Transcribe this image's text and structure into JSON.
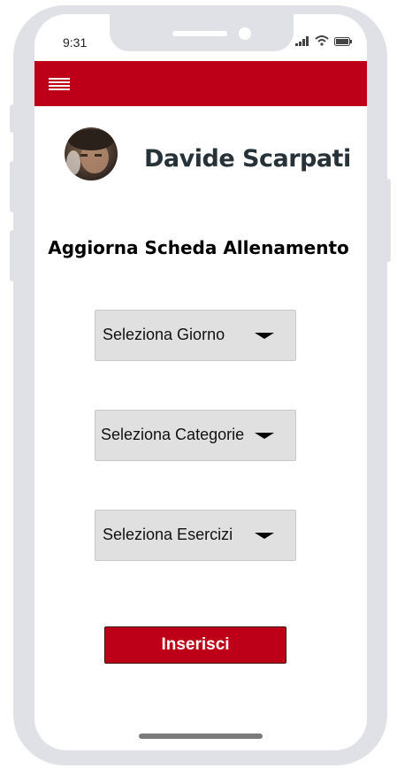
{
  "status_bar": {
    "time": "9:31",
    "icons": [
      "signal-icon",
      "wifi-icon",
      "battery-icon"
    ]
  },
  "header": {
    "menu_icon": "hamburger-menu-icon",
    "background_color": "#bd0017"
  },
  "profile": {
    "name": "Davide Scarpati"
  },
  "page": {
    "title": "Aggiorna Scheda Allenamento"
  },
  "form": {
    "day_select": {
      "value": "Seleziona Giorno"
    },
    "category_select": {
      "value": "Seleziona Categorie"
    },
    "exercise_select": {
      "value": "Seleziona Esercizi"
    },
    "submit_label": "Inserisci"
  },
  "colors": {
    "accent": "#bd0017",
    "name_text": "#263238",
    "select_bg": "#e0e0e0"
  }
}
